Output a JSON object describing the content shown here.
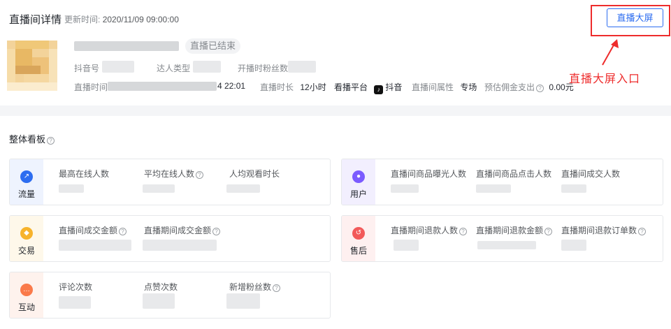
{
  "header": {
    "title": "直播间详情",
    "update_label": "更新时间:",
    "update_time": "2020/11/09 09:00:00",
    "big_screen_button": "直播大屏",
    "annotation": "直播大屏入口",
    "status_badge": "直播已结束",
    "douyin_id_label": "抖音号",
    "creator_type_label": "达人类型",
    "start_fans_label": "开播时粉丝数",
    "live_time_label": "直播时间",
    "live_time_value": "4 22:01",
    "duration_label": "直播时长",
    "duration_value": "12小时",
    "platform_label": "看播平台",
    "platform_value": "抖音",
    "attribute_label": "直播间属性",
    "attribute_value": "专场",
    "commission_label": "预估佣金支出",
    "commission_value": "0.00元",
    "tiktok_icon": "tiktok-icon",
    "help_icon": "question-circle-icon"
  },
  "board": {
    "title": "整体看板",
    "cards": [
      {
        "category": "流量",
        "icon": "trend-icon",
        "color": "#2d6df0",
        "metrics": [
          "最高在线人数",
          "平均在线人数",
          "人均观看时长"
        ]
      },
      {
        "category": "用户",
        "icon": "user-icon",
        "color": "#7b5bff",
        "metrics": [
          "直播间商品曝光人数",
          "直播间商品点击人数",
          "直播间成交人数"
        ]
      },
      {
        "category": "交易",
        "icon": "coin-icon",
        "color": "#f7b32b",
        "metrics": [
          "直播间成交金额",
          "直播期间成交金额"
        ]
      },
      {
        "category": "售后",
        "icon": "refund-icon",
        "color": "#f25a5a",
        "metrics": [
          "直播期间退款人数",
          "直播期间退款金额",
          "直播期间退款订单数"
        ]
      },
      {
        "category": "互动",
        "icon": "chat-icon",
        "color": "#fa7a4a",
        "metrics": [
          "评论次数",
          "点赞次数",
          "新增粉丝数"
        ]
      }
    ]
  }
}
